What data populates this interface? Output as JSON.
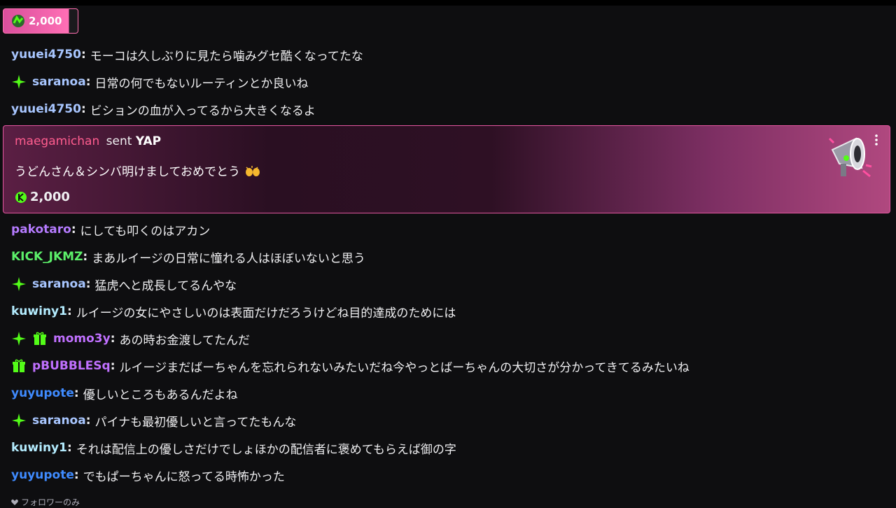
{
  "pinned": {
    "amount": "2,000",
    "icon": "kick-coin-icon"
  },
  "messages_top": [
    {
      "user": "yuuei4750",
      "text": "モーコは久しぶりに見たら噛みグセ酷くなってたな",
      "badges": []
    },
    {
      "user": "saranoa",
      "text": "日常の何でもないルーティンとか良いね",
      "badges": [
        "sparkle-badge"
      ]
    },
    {
      "user": "yuuei4750",
      "text": "ビションの血が入ってるから大きくなるよ",
      "badges": []
    }
  ],
  "yap": {
    "sender": "maegamichan",
    "sent_label": "sent",
    "item": "YAP",
    "text": "うどんさん＆シンバ明けましておめでとう",
    "emoji": "raising-hands-emoji",
    "amount": "2,000"
  },
  "messages_bottom": [
    {
      "user": "pakotaro",
      "text": "にしても叩くのはアカン",
      "badges": []
    },
    {
      "user": "KICK_JKMZ",
      "text": "まあルイージの日常に憧れる人はほぼいないと思う",
      "badges": []
    },
    {
      "user": "saranoa",
      "text": "猛虎へと成長してるんやな",
      "badges": [
        "sparkle-badge"
      ]
    },
    {
      "user": "kuwiny1",
      "text": "ルイージの女にやさしいのは表面だけだろうけどね目的達成のためには",
      "badges": []
    },
    {
      "user": "momo3y",
      "text": "あの時お金渡してたんだ",
      "badges": [
        "sparkle-badge",
        "gift-badge"
      ]
    },
    {
      "user": "pBUBBLESq",
      "text": "ルイージまだばーちゃんを忘れられないみたいだね今やっとばーちゃんの大切さが分かってきてるみたいね",
      "badges": [
        "gift-badge"
      ]
    },
    {
      "user": "yuyupote",
      "text": "優しいところもあるんだよね",
      "badges": []
    },
    {
      "user": "saranoa",
      "text": "パイナも最初優しいと言ってたもんな",
      "badges": [
        "sparkle-badge"
      ]
    },
    {
      "user": "kuwiny1",
      "text": "それは配信上の優しさだけでしょほかの配信者に褒めてもらえば御の字",
      "badges": []
    },
    {
      "user": "yuyupote",
      "text": "でもぱーちゃんに怒ってる時怖かった",
      "badges": []
    }
  ],
  "footer": {
    "label": "フォロワーのみ"
  },
  "colors": {
    "accent_pink": "#e2569f",
    "kick_green": "#53fc18"
  }
}
